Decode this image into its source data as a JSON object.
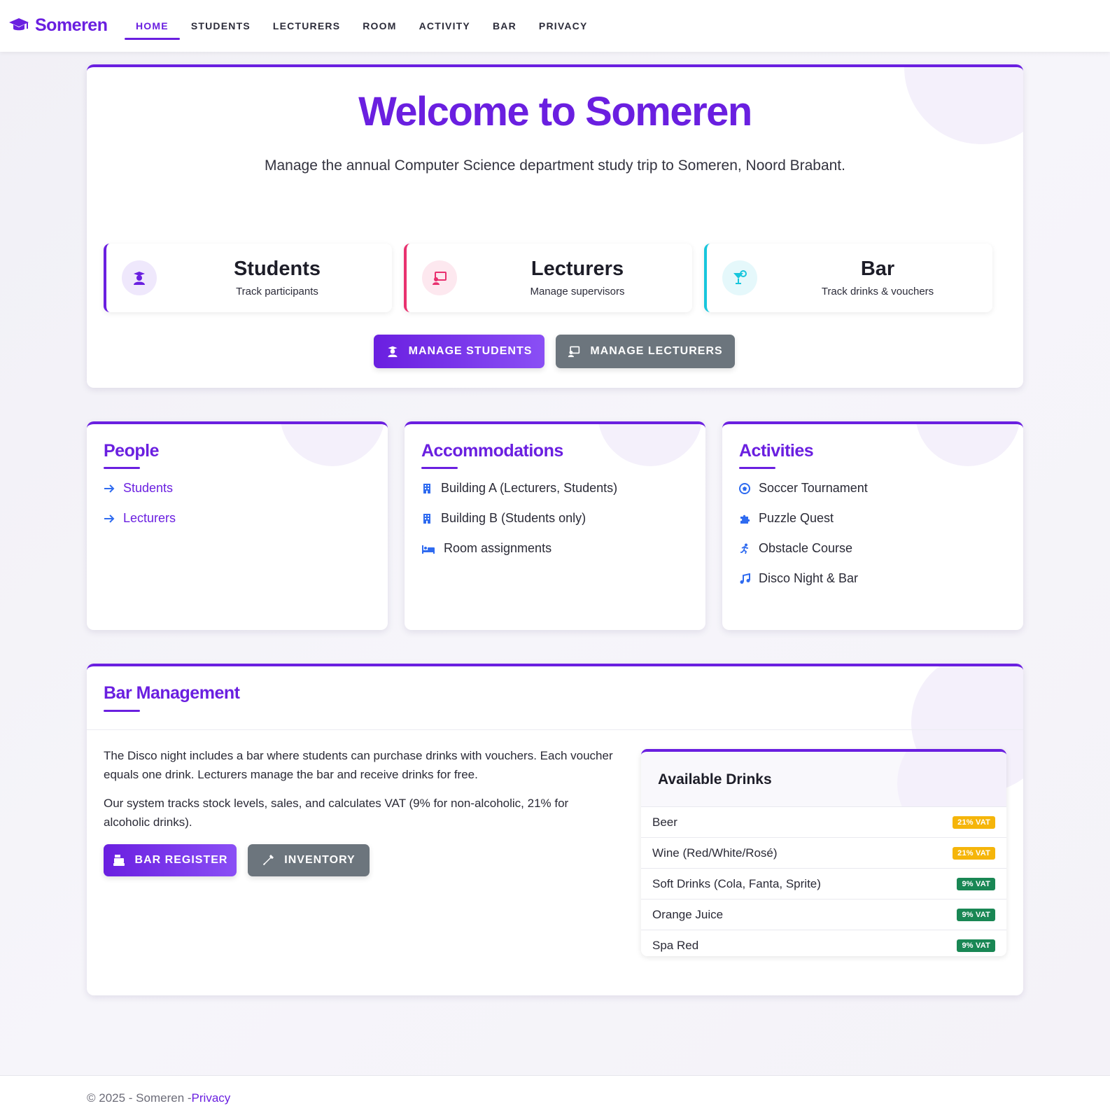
{
  "brand": {
    "name": "Someren",
    "icon": "graduation-cap-icon"
  },
  "nav": {
    "items": [
      {
        "label": "HOME",
        "active": true
      },
      {
        "label": "STUDENTS"
      },
      {
        "label": "LECTURERS"
      },
      {
        "label": "ROOM"
      },
      {
        "label": "ACTIVITY"
      },
      {
        "label": "BAR"
      },
      {
        "label": "PRIVACY"
      }
    ]
  },
  "hero": {
    "title": "Welcome to Someren",
    "subtitle": "Manage the annual Computer Science department study trip to Someren, Noord Brabant.",
    "stats": [
      {
        "title": "Students",
        "subtitle": "Track participants",
        "icon": "user-graduate-icon",
        "accent": "#6a1fe0",
        "circle_bg": "#efe8fc"
      },
      {
        "title": "Lecturers",
        "subtitle": "Manage supervisors",
        "icon": "chalkboard-teacher-icon",
        "accent": "#e8316f",
        "circle_bg": "#fde8ef"
      },
      {
        "title": "Bar",
        "subtitle": "Track drinks & vouchers",
        "icon": "cocktail-icon",
        "accent": "#18c6dc",
        "circle_bg": "#e5f8fb"
      }
    ],
    "buttons": {
      "manage_students": "MANAGE STUDENTS",
      "manage_lecturers": "MANAGE LECTURERS"
    }
  },
  "people": {
    "title": "People",
    "items": [
      {
        "label": "Students",
        "icon": "arrow-right-icon"
      },
      {
        "label": "Lecturers",
        "icon": "arrow-right-icon"
      }
    ]
  },
  "accommodations": {
    "title": "Accommodations",
    "items": [
      {
        "label": "Building A (Lecturers, Students)",
        "icon": "building-icon"
      },
      {
        "label": "Building B (Students only)",
        "icon": "building-icon"
      },
      {
        "label": "Room assignments",
        "icon": "bed-icon"
      }
    ]
  },
  "activities": {
    "title": "Activities",
    "items": [
      {
        "label": "Soccer Tournament",
        "icon": "futbol-icon"
      },
      {
        "label": "Puzzle Quest",
        "icon": "puzzle-piece-icon"
      },
      {
        "label": "Obstacle Course",
        "icon": "running-icon"
      },
      {
        "label": "Disco Night & Bar",
        "icon": "music-icon"
      }
    ]
  },
  "bar_management": {
    "title": "Bar Management",
    "paragraph1": "The Disco night includes a bar where students can purchase drinks with vouchers. Each voucher equals one drink. Lecturers manage the bar and receive drinks for free.",
    "paragraph2": "Our system tracks stock levels, sales, and calculates VAT (9% for non-alcoholic, 21% for alcoholic drinks).",
    "buttons": {
      "register": "BAR REGISTER",
      "inventory": "INVENTORY"
    },
    "drinks": {
      "title": "Available Drinks",
      "items": [
        {
          "name": "Beer",
          "vat": "21% VAT",
          "color": "#f5b50a"
        },
        {
          "name": "Wine (Red/White/Rosé)",
          "vat": "21% VAT",
          "color": "#f5b50a"
        },
        {
          "name": "Soft Drinks (Cola, Fanta, Sprite)",
          "vat": "9% VAT",
          "color": "#198754"
        },
        {
          "name": "Orange Juice",
          "vat": "9% VAT",
          "color": "#198754"
        },
        {
          "name": "Spa Red",
          "vat": "9% VAT",
          "color": "#198754"
        }
      ]
    }
  },
  "footer": {
    "text": "© 2025 - Someren -",
    "link": "Privacy"
  },
  "colors": {
    "accent": "#6a1fe0",
    "secondary": "#6c757d",
    "link_icon": "#2f6bf0"
  }
}
